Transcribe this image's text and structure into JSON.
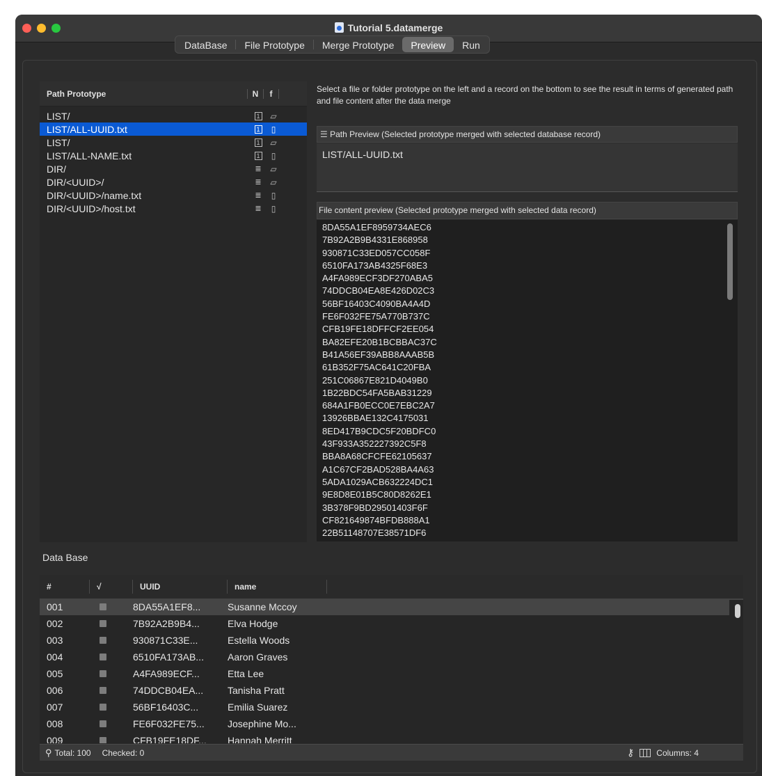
{
  "window": {
    "title": "Tutorial 5.datamerge"
  },
  "tabs": [
    {
      "label": "DataBase"
    },
    {
      "label": "File Prototype"
    },
    {
      "label": "Merge Prototype"
    },
    {
      "label": "Preview",
      "active": true
    },
    {
      "label": "Run"
    }
  ],
  "prototypes": {
    "header": {
      "name": "Path Prototype",
      "n": "N",
      "f": "f"
    },
    "rows": [
      {
        "path": "LIST/",
        "kind": "folder",
        "n_icon": "1"
      },
      {
        "path": "LIST/ALL-UUID.txt",
        "kind": "file",
        "n_icon": "1",
        "selected": true
      },
      {
        "path": "LIST/",
        "kind": "folder",
        "n_icon": "1"
      },
      {
        "path": "LIST/ALL-NAME.txt",
        "kind": "file",
        "n_icon": "1"
      },
      {
        "path": "DIR/",
        "kind": "folder",
        "n_icon": "list"
      },
      {
        "path": "DIR/<UUID>/",
        "kind": "folder",
        "n_icon": "list"
      },
      {
        "path": "DIR/<UUID>/name.txt",
        "kind": "file",
        "n_icon": "list"
      },
      {
        "path": "DIR/<UUID>/host.txt",
        "kind": "file",
        "n_icon": "list"
      }
    ]
  },
  "help": {
    "text": "Select a file or folder prototype  on the left and a record on the bottom to see the result in terms of generated path and file content after the data merge"
  },
  "path_preview": {
    "header": "Path Preview (Selected prototype merged with selected database record)",
    "value": "LIST/ALL-UUID.txt"
  },
  "file_preview": {
    "header": "File content preview (Selected prototype merged with selected data record)",
    "lines": [
      "8DA55A1EF8959734AEC6",
      "7B92A2B9B4331E868958",
      "930871C33ED057CC058F",
      "6510FA173AB4325F68E3",
      "A4FA989ECF3DF270ABA5",
      "74DDCB04EA8E426D02C3",
      "56BF16403C4090BA4A4D",
      "FE6F032FE75A770B737C",
      "CFB19FE18DFFCF2EE054",
      "BA82EFE20B1BCBBAC37C",
      "B41A56EF39ABB8AAAB5B",
      "61B352F75AC641C20FBA",
      "251C06867E821D4049B0",
      "1B22BDC54FA5BAB31229",
      "684A1FB0ECC0E7EBC2A7",
      "13926BBAE132C4175031",
      "8ED417B9CDC5F20BDFC0",
      "43F933A352227392C5F8",
      "BBA8A68CFCFE62105637",
      "A1C67CF2BAD528BA4A63",
      "5ADA1029ACB632224DC1",
      "9E8D8E01B5C80D8262E1",
      "3B378F9BD29501403F6F",
      "CF821649874BFDB888A1",
      "22B51148707E38571DF6"
    ]
  },
  "database": {
    "label": "Data Base",
    "columns": [
      "#",
      "√",
      "UUID",
      "name"
    ],
    "rows": [
      {
        "num": "001",
        "uuid": "8DA55A1EF8...",
        "name": "Susanne Mccoy",
        "selected": true
      },
      {
        "num": "002",
        "uuid": "7B92A2B9B4...",
        "name": "Elva Hodge"
      },
      {
        "num": "003",
        "uuid": "930871C33E...",
        "name": "Estella Woods"
      },
      {
        "num": "004",
        "uuid": "6510FA173AB...",
        "name": "Aaron Graves"
      },
      {
        "num": "005",
        "uuid": "A4FA989ECF...",
        "name": "Etta Lee"
      },
      {
        "num": "006",
        "uuid": "74DDCB04EA...",
        "name": "Tanisha Pratt"
      },
      {
        "num": "007",
        "uuid": "56BF16403C...",
        "name": "Emilia Suarez"
      },
      {
        "num": "008",
        "uuid": "FE6F032FE75...",
        "name": "Josephine Mo..."
      },
      {
        "num": "009",
        "uuid": "CFB19FE18DF...",
        "name": "Hannah Merritt"
      }
    ]
  },
  "status": {
    "total": "Total: 100",
    "checked": "Checked: 0",
    "columns": "Columns: 4"
  }
}
